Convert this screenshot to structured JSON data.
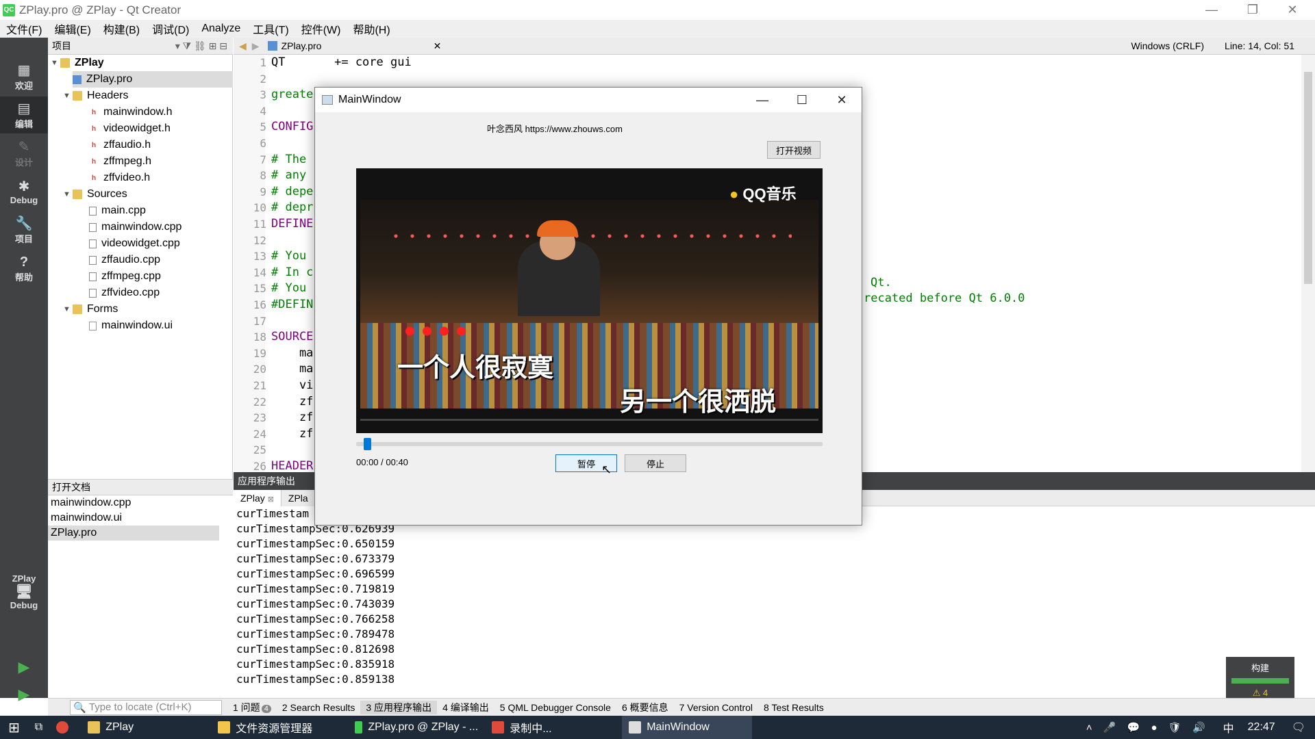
{
  "window": {
    "title": "ZPlay.pro @ ZPlay - Qt Creator",
    "app_icon": "QC",
    "controls": {
      "minimize": "—",
      "restore": "❐",
      "close": "✕"
    }
  },
  "menubar": [
    "文件(F)",
    "编辑(E)",
    "构建(B)",
    "调试(D)",
    "Analyze",
    "工具(T)",
    "控件(W)",
    "帮助(H)"
  ],
  "modes": [
    {
      "icon": "grid-icon",
      "glyph": "▦",
      "label": "欢迎"
    },
    {
      "icon": "edit-icon",
      "glyph": "▤",
      "label": "编辑"
    },
    {
      "icon": "design-icon",
      "glyph": "✎",
      "label": "设计"
    },
    {
      "icon": "debug-icon",
      "glyph": "✱",
      "label": "Debug"
    },
    {
      "icon": "wrench-icon",
      "glyph": "🔧",
      "label": "项目"
    },
    {
      "icon": "help-icon",
      "glyph": "?",
      "label": "帮助"
    }
  ],
  "kit": {
    "project": "ZPlay",
    "config": "Debug"
  },
  "project_panel": {
    "title": "项目",
    "root": "ZPlay",
    "pro_file": "ZPlay.pro",
    "headers_label": "Headers",
    "headers": [
      "mainwindow.h",
      "videowidget.h",
      "zffaudio.h",
      "zffmpeg.h",
      "zffvideo.h"
    ],
    "sources_label": "Sources",
    "sources": [
      "main.cpp",
      "mainwindow.cpp",
      "videowidget.cpp",
      "zffaudio.cpp",
      "zffmpeg.cpp",
      "zffvideo.cpp"
    ],
    "forms_label": "Forms",
    "forms": [
      "mainwindow.ui"
    ]
  },
  "open_docs": {
    "title": "打开文档",
    "items": [
      "mainwindow.cpp",
      "mainwindow.ui",
      "ZPlay.pro"
    ]
  },
  "editor": {
    "file": "ZPlay.pro",
    "encoding": "Windows (CRLF)",
    "position": "Line: 14, Col: 51",
    "lines": [
      {
        "n": "1",
        "text": "QT       += core gui",
        "cls": ""
      },
      {
        "n": "2",
        "text": "",
        "cls": ""
      },
      {
        "n": "3",
        "text": "greate",
        "cls": "cm"
      },
      {
        "n": "4",
        "text": "",
        "cls": ""
      },
      {
        "n": "5",
        "text": "CONFIG",
        "cls": "kw"
      },
      {
        "n": "6",
        "text": "",
        "cls": ""
      },
      {
        "n": "7",
        "text": "# The",
        "cls": "cm"
      },
      {
        "n": "8",
        "text": "# any",
        "cls": "cm"
      },
      {
        "n": "9",
        "text": "# depe",
        "cls": "cm"
      },
      {
        "n": "10",
        "text": "# depr",
        "cls": "cm"
      },
      {
        "n": "11",
        "text": "DEFINE",
        "cls": "kw"
      },
      {
        "n": "12",
        "text": "",
        "cls": ""
      },
      {
        "n": "13",
        "text": "# You",
        "cls": "cm"
      },
      {
        "n": "14",
        "text": "# In c",
        "cls": "cm"
      },
      {
        "n": "15",
        "text": "# You",
        "cls": "cm"
      },
      {
        "n": "16",
        "text": "#DEFIN",
        "cls": "cm"
      },
      {
        "n": "17",
        "text": "",
        "cls": ""
      },
      {
        "n": "18",
        "text": "SOURCE",
        "cls": "kw"
      },
      {
        "n": "19",
        "text": "    ma",
        "cls": ""
      },
      {
        "n": "20",
        "text": "    ma",
        "cls": ""
      },
      {
        "n": "21",
        "text": "    vi",
        "cls": ""
      },
      {
        "n": "22",
        "text": "    zf",
        "cls": ""
      },
      {
        "n": "23",
        "text": "    zf",
        "cls": ""
      },
      {
        "n": "24",
        "text": "    zf",
        "cls": ""
      },
      {
        "n": "25",
        "text": "",
        "cls": ""
      },
      {
        "n": "26",
        "text": "HEADER",
        "cls": "kw"
      }
    ],
    "tail_15": "Qt.",
    "tail_16": "recated before Qt 6.0.0"
  },
  "output": {
    "title": "应用程序输出",
    "tabs": [
      "ZPlay",
      "ZPla"
    ],
    "lines": [
      "curTimestam",
      "curTimestampSec:0.626939",
      "curTimestampSec:0.650159",
      "curTimestampSec:0.673379",
      "curTimestampSec:0.696599",
      "curTimestampSec:0.719819",
      "curTimestampSec:0.743039",
      "curTimestampSec:0.766258",
      "curTimestampSec:0.789478",
      "curTimestampSec:0.812698",
      "curTimestampSec:0.835918",
      "curTimestampSec:0.859138"
    ]
  },
  "statusbar": {
    "locate_placeholder": "Type to locate (Ctrl+K)",
    "tabs": [
      {
        "label": "1 问题",
        "badge": "4"
      },
      {
        "label": "2 Search Results",
        "badge": ""
      },
      {
        "label": "3 应用程序输出",
        "badge": ""
      },
      {
        "label": "4 编译输出",
        "badge": ""
      },
      {
        "label": "5 QML Debugger Console",
        "badge": ""
      },
      {
        "label": "6 概要信息",
        "badge": ""
      },
      {
        "label": "7 Version Control",
        "badge": ""
      },
      {
        "label": "8 Test Results",
        "badge": ""
      }
    ]
  },
  "build_box": {
    "label": "构建",
    "warnings": "4"
  },
  "dialog": {
    "title": "MainWindow",
    "site": "叶念西风 https://www.zhouws.com",
    "open_button": "打开视频",
    "video_logo": "QQ音乐",
    "lyric1": "一个人很寂寞",
    "lyric2": "另一个很洒脱",
    "time": "00:00  /  00:40",
    "progress": 0.016,
    "pause_button": "暂停",
    "stop_button": "停止"
  },
  "taskbar": {
    "items": [
      {
        "label": "ZPlay",
        "color": "#e8c35a"
      },
      {
        "label": "文件资源管理器",
        "color": "#f3c64b"
      },
      {
        "label": "ZPlay.pro @ ZPlay - ...",
        "color": "#41cd52"
      },
      {
        "label": "录制中...",
        "color": "#e04a3a"
      },
      {
        "label": "MainWindow",
        "color": "#dddddd"
      }
    ],
    "ime": "中",
    "clock": "22:47"
  }
}
